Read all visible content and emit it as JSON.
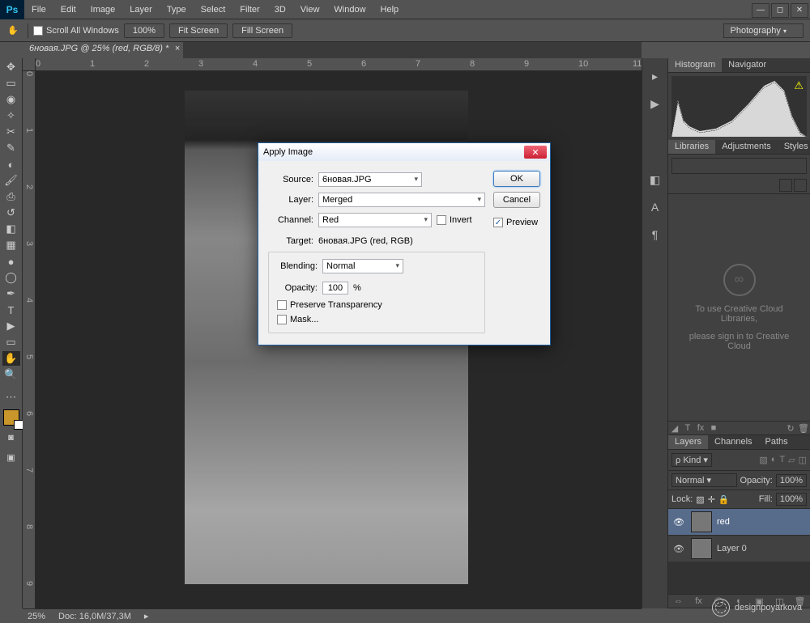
{
  "menubar": {
    "items": [
      "File",
      "Edit",
      "Image",
      "Layer",
      "Type",
      "Select",
      "Filter",
      "3D",
      "View",
      "Window",
      "Help"
    ]
  },
  "optionsBar": {
    "scrollAll": "Scroll All Windows",
    "zoom": "100%",
    "fit": "Fit Screen",
    "fill": "Fill Screen",
    "workspace": "Photography"
  },
  "docTab": {
    "title": "6новая.JPG @ 25% (red, RGB/8) *"
  },
  "status": {
    "zoom": "25%",
    "doc": "Doc: 16,0M/37,3M"
  },
  "histogramTabs": [
    "Histogram",
    "Navigator"
  ],
  "libTabs": [
    "Libraries",
    "Adjustments",
    "Styles"
  ],
  "lib": {
    "msg1": "To use Creative Cloud Libraries,",
    "msg2": "please sign in to Creative Cloud"
  },
  "layerTabs": [
    "Layers",
    "Channels",
    "Paths"
  ],
  "layerPanel": {
    "kind": "Kind",
    "blend": "Normal",
    "opacityLbl": "Opacity:",
    "opacity": "100%",
    "lock": "Lock:",
    "fillLbl": "Fill:",
    "fill": "100%"
  },
  "layers": [
    {
      "name": "red"
    },
    {
      "name": "Layer 0"
    }
  ],
  "dialog": {
    "title": "Apply Image",
    "source": {
      "label": "Source:",
      "value": "6новая.JPG"
    },
    "layer": {
      "label": "Layer:",
      "value": "Merged"
    },
    "channel": {
      "label": "Channel:",
      "value": "Red",
      "invert": "Invert"
    },
    "target": {
      "label": "Target:",
      "value": "6новая.JPG (red, RGB)"
    },
    "blending": {
      "label": "Blending:",
      "value": "Normal"
    },
    "opacity": {
      "label": "Opacity:",
      "value": "100",
      "unit": "%"
    },
    "preserve": "Preserve Transparency",
    "mask": "Mask...",
    "ok": "OK",
    "cancel": "Cancel",
    "preview": "Preview"
  },
  "watermark": "designpoyarkova"
}
